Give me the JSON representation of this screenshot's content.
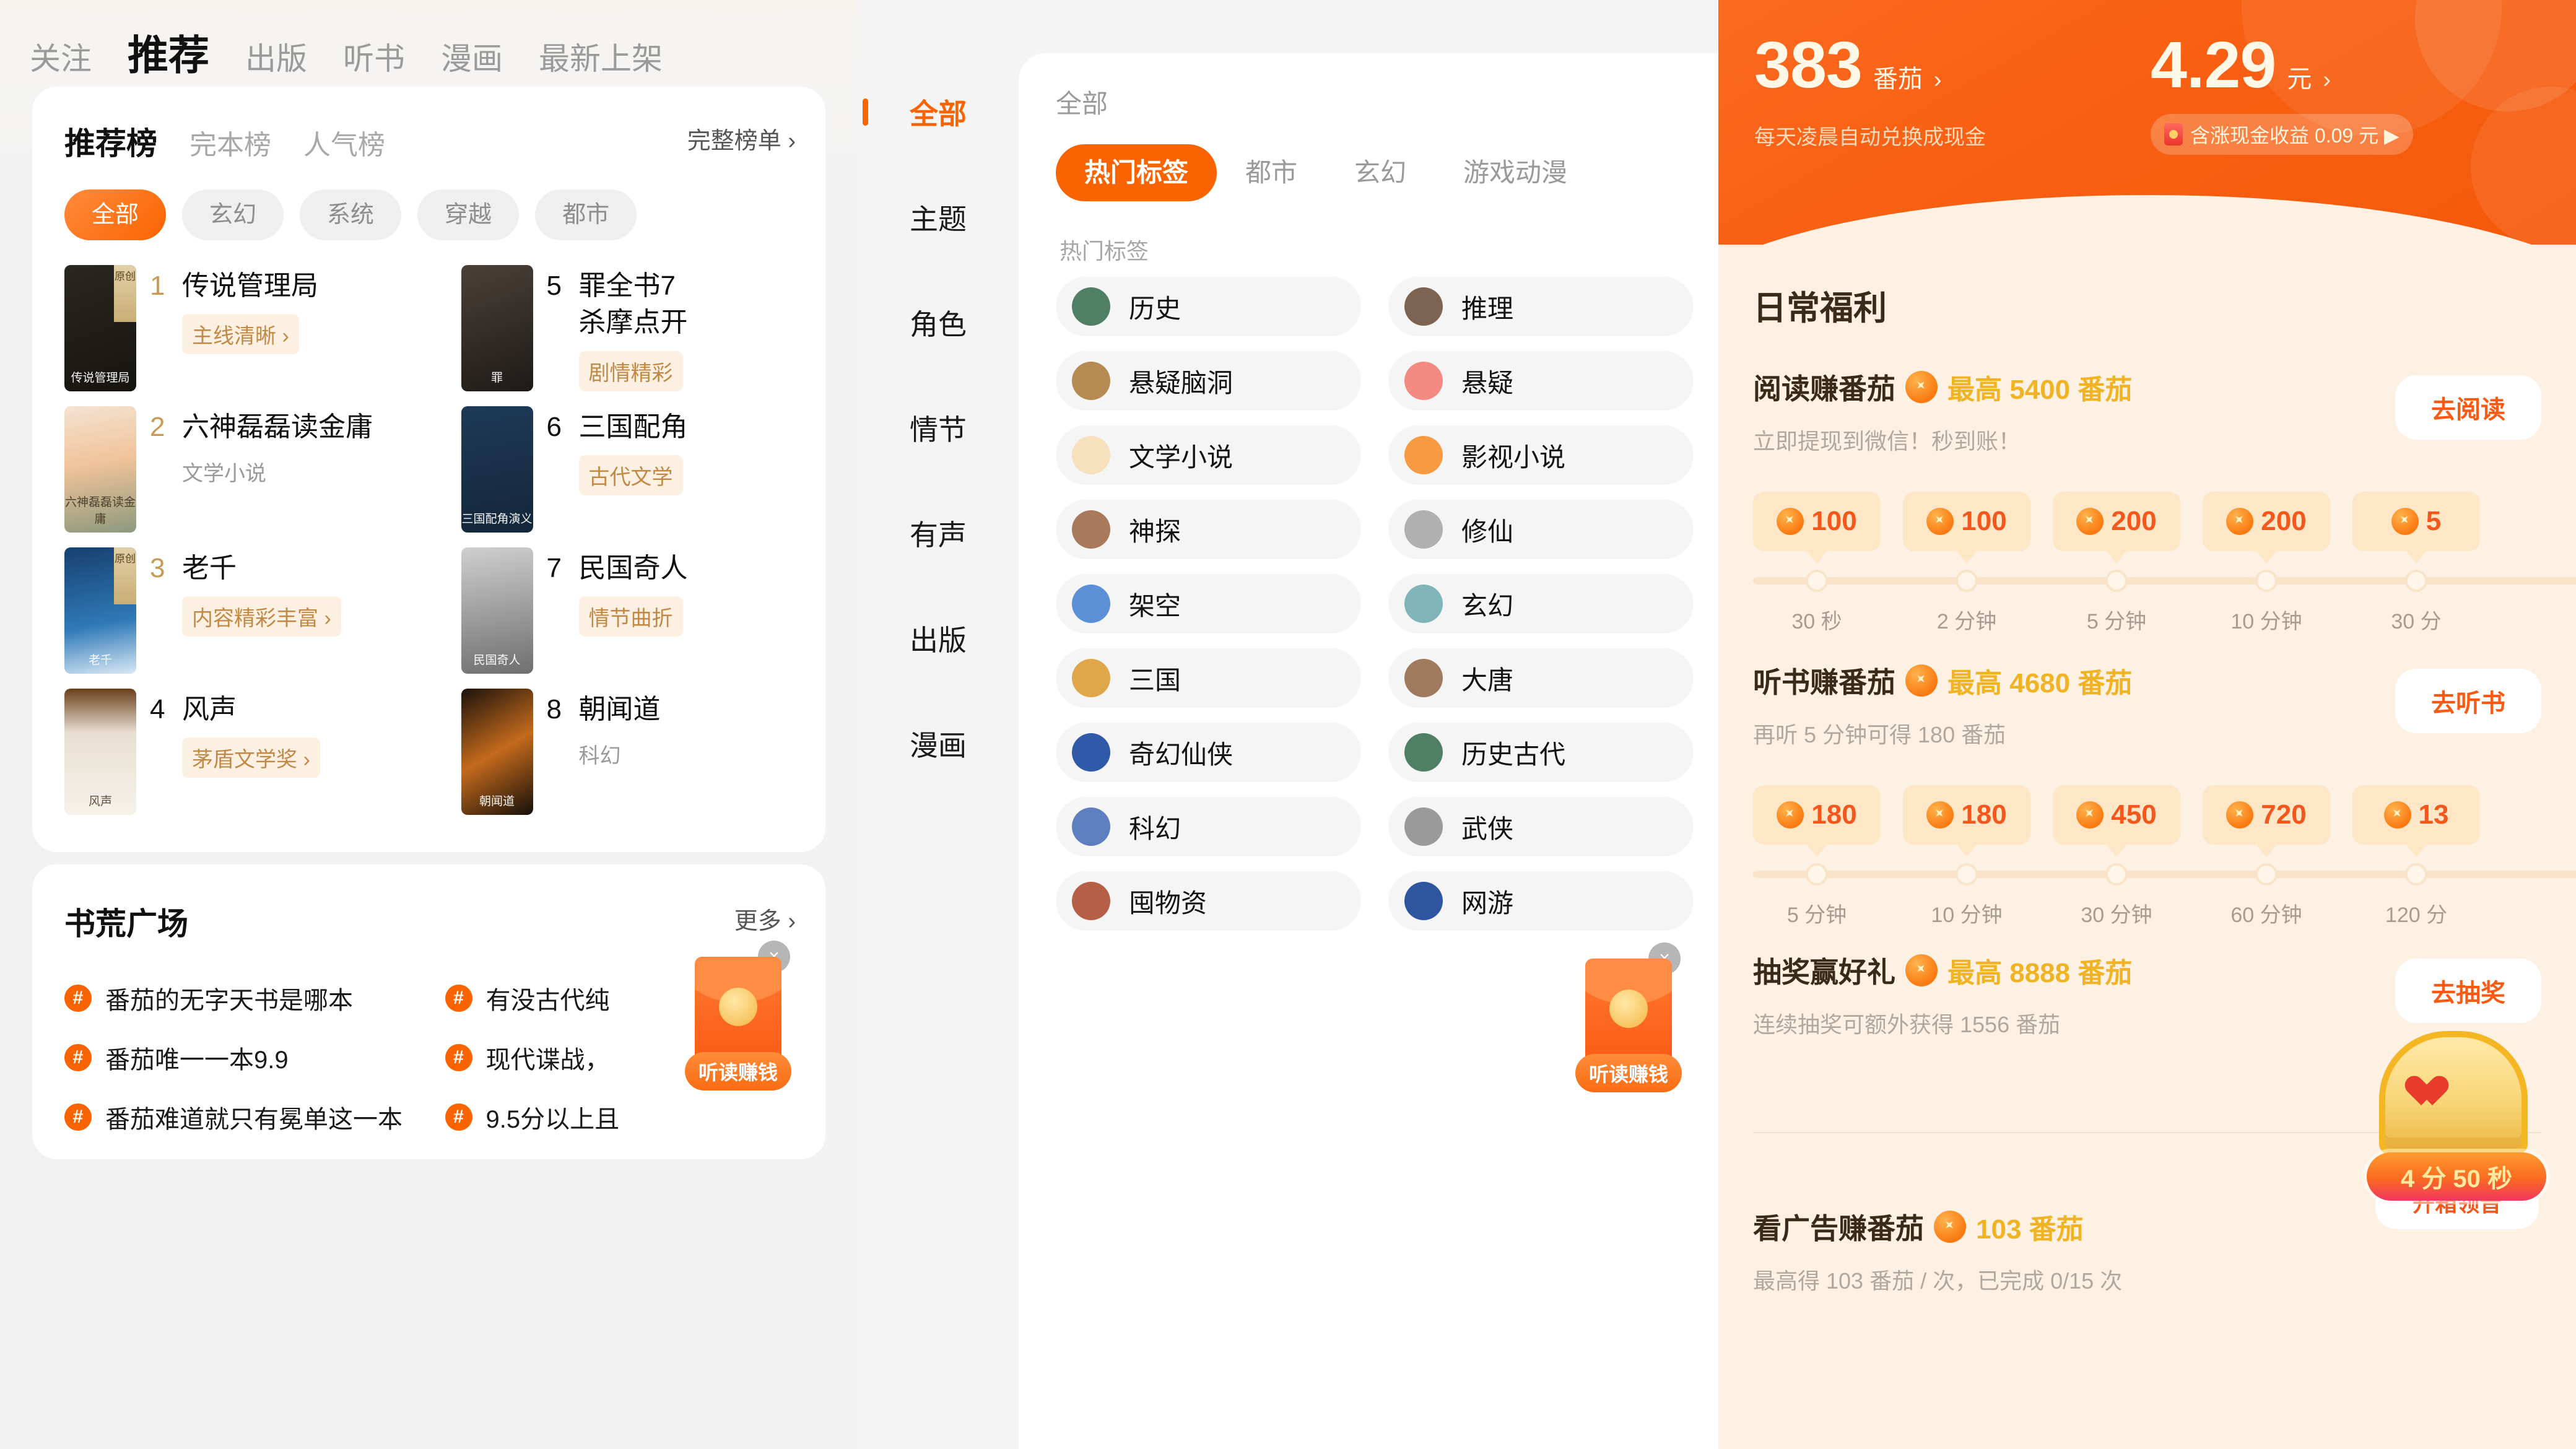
{
  "left": {
    "top_tabs": [
      {
        "label": "关注",
        "active": false
      },
      {
        "label": "推荐",
        "active": true
      },
      {
        "label": "出版",
        "active": false
      },
      {
        "label": "听书",
        "active": false
      },
      {
        "label": "漫画",
        "active": false
      },
      {
        "label": "最新上架",
        "active": false
      }
    ],
    "rank_tabs": [
      {
        "label": "推荐榜",
        "active": true
      },
      {
        "label": "完本榜",
        "active": false
      },
      {
        "label": "人气榜",
        "active": false
      }
    ],
    "rank_more": "完整榜单 ›",
    "chips": [
      {
        "label": "全部",
        "active": true
      },
      {
        "label": "玄幻",
        "active": false
      },
      {
        "label": "系统",
        "active": false
      },
      {
        "label": "穿越",
        "active": false
      },
      {
        "label": "都市",
        "active": false
      }
    ],
    "books": [
      {
        "rank": "1",
        "title": "传说管理局",
        "title2": "",
        "tag": "主线清晰 ›",
        "sub": "",
        "original": "原创",
        "cover_text": "传说管理局"
      },
      {
        "rank": "5",
        "title": "罪全书7",
        "title2": "杀摩点开",
        "tag": "剧情精彩",
        "sub": "",
        "original": "",
        "cover_text": "罪"
      },
      {
        "rank": "2",
        "title": "六神磊磊读金庸",
        "title2": "",
        "tag": "",
        "sub": "文学小说",
        "original": "",
        "cover_text": "六神磊磊读金庸"
      },
      {
        "rank": "6",
        "title": "三国配角",
        "title2": "",
        "tag": "古代文学",
        "sub": "",
        "original": "",
        "cover_text": "三国配角演义"
      },
      {
        "rank": "3",
        "title": "老千",
        "title2": "",
        "tag": "内容精彩丰富 ›",
        "sub": "",
        "original": "原创",
        "cover_text": "老千"
      },
      {
        "rank": "7",
        "title": "民国奇人",
        "title2": "",
        "tag": "情节曲折",
        "sub": "",
        "original": "",
        "cover_text": "民国奇人"
      },
      {
        "rank": "4",
        "title": "风声",
        "title2": "",
        "tag": "茅盾文学奖 ›",
        "sub": "",
        "original": "",
        "cover_text": "风声"
      },
      {
        "rank": "8",
        "title": "朝闻道",
        "title2": "",
        "tag": "",
        "sub": "科幻",
        "original": "",
        "cover_text": "朝闻道"
      }
    ],
    "plaza": {
      "title": "书荒广场",
      "more": "更多 ›",
      "items": [
        "番茄的无字天书是哪本",
        "有没古代纯",
        "番茄唯一一本9.9",
        "现代谍战，",
        "番茄难道就只有冕单这一本",
        "9.5分以上且"
      ]
    },
    "packet": {
      "button": "听读赚钱",
      "close": "×"
    }
  },
  "middle": {
    "sidebar": [
      {
        "label": "全部",
        "active": true
      },
      {
        "label": "主题",
        "active": false
      },
      {
        "label": "角色",
        "active": false
      },
      {
        "label": "情节",
        "active": false
      },
      {
        "label": "有声",
        "active": false
      },
      {
        "label": "出版",
        "active": false
      },
      {
        "label": "漫画",
        "active": false
      }
    ],
    "all_label": "全部",
    "tabs": [
      {
        "label": "热门标签",
        "active": true
      },
      {
        "label": "都市",
        "active": false
      },
      {
        "label": "玄幻",
        "active": false
      },
      {
        "label": "游戏动漫",
        "active": false
      }
    ],
    "section_label": "热门标签",
    "tags": [
      {
        "name": "历史",
        "color": "#4f7f64"
      },
      {
        "name": "推理",
        "color": "#7d6452"
      },
      {
        "name": "悬疑脑洞",
        "color": "#b58a53"
      },
      {
        "name": "悬疑",
        "color": "#f28a82"
      },
      {
        "name": "文学小说",
        "color": "#f7e0bc"
      },
      {
        "name": "影视小说",
        "color": "#f79a42"
      },
      {
        "name": "神探",
        "color": "#a8795a"
      },
      {
        "name": "修仙",
        "color": "#b0b0b0"
      },
      {
        "name": "架空",
        "color": "#5b8fd6"
      },
      {
        "name": "玄幻",
        "color": "#7fb4b8"
      },
      {
        "name": "三国",
        "color": "#e0a64a"
      },
      {
        "name": "大唐",
        "color": "#a07a5e"
      },
      {
        "name": "奇幻仙侠",
        "color": "#2e5aa8"
      },
      {
        "name": "历史古代",
        "color": "#4f7f64"
      },
      {
        "name": "科幻",
        "color": "#5d7fbf"
      },
      {
        "name": "武侠",
        "color": "#9a9a9a"
      },
      {
        "name": "囤物资",
        "color": "#b45f46"
      },
      {
        "name": "网游",
        "color": "#2e56a0"
      }
    ],
    "packet": {
      "button": "听读赚钱",
      "close": "×"
    }
  },
  "right": {
    "hero": {
      "tomato_value": "383",
      "tomato_unit": "番茄",
      "tomato_chevron": "›",
      "tomato_sub": "每天凌晨自动兑换成现金",
      "cash_value": "4.29",
      "cash_unit": "元",
      "cash_chevron": "›",
      "cash_badge": "含涨现金收益 0.09 元 ▶"
    },
    "section_title": "日常福利",
    "rewards": [
      {
        "name": "阅读赚番茄",
        "max": "最高 5400 番茄",
        "sub": "立即提现到微信！秒到账！",
        "button": "去阅读",
        "nodes": [
          {
            "value": "100",
            "label": "30 秒"
          },
          {
            "value": "100",
            "label": "2 分钟"
          },
          {
            "value": "200",
            "label": "5 分钟"
          },
          {
            "value": "200",
            "label": "10 分钟"
          },
          {
            "value": "5",
            "label": "30 分"
          }
        ]
      },
      {
        "name": "听书赚番茄",
        "max": "最高 4680 番茄",
        "sub": "再听 5 分钟可得 180 番茄",
        "button": "去听书",
        "nodes": [
          {
            "value": "180",
            "label": "5 分钟"
          },
          {
            "value": "180",
            "label": "10 分钟"
          },
          {
            "value": "450",
            "label": "30 分钟"
          },
          {
            "value": "720",
            "label": "60 分钟"
          },
          {
            "value": "13",
            "label": "120 分"
          }
        ]
      }
    ],
    "lottery": {
      "name": "抽奖赢好礼",
      "max": "最高 8888 番茄",
      "sub": "连续抽奖可额外获得 1556 番茄",
      "button": "去抽奖"
    },
    "ads": {
      "name": "看广告赚番茄",
      "max": "103 番茄",
      "sub": "最高得 103 番茄 / 次，已完成 0/15 次"
    },
    "chest": {
      "timer": "4 分 50 秒",
      "caption": "开箱领音"
    }
  }
}
